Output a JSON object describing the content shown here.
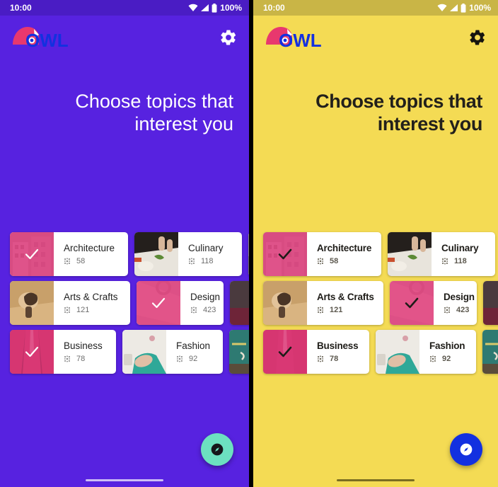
{
  "screens": [
    {
      "theme": "purple",
      "background_color": "#5722E0",
      "statusbar": {
        "time": "10:00",
        "battery": "100%",
        "wifi_icon": "wifi-icon",
        "signal_icon": "signal-icon",
        "battery_icon": "battery-icon"
      },
      "appbar": {
        "logo_text": "OWL",
        "logo_icon": "owl-logo-icon",
        "settings_icon": "gear-icon"
      },
      "headline": "Choose topics that interest you",
      "fab": {
        "icon": "explore-compass-icon",
        "color": "#6CE0C0"
      }
    },
    {
      "theme": "yellow",
      "background_color": "#F4DB54",
      "statusbar": {
        "time": "10:00",
        "battery": "100%",
        "wifi_icon": "wifi-icon",
        "signal_icon": "signal-icon",
        "battery_icon": "battery-icon"
      },
      "appbar": {
        "logo_text": "OWL",
        "logo_icon": "owl-logo-icon",
        "settings_icon": "gear-icon"
      },
      "headline": "Choose topics that interest you",
      "fab": {
        "icon": "explore-compass-icon",
        "color": "#1330E0"
      }
    }
  ],
  "topics": {
    "selection_tint_color": "#E53B7E",
    "count_icon": "grain-icon",
    "rows": [
      [
        {
          "name": "Architecture",
          "count": "58",
          "selected": true,
          "image": "architecture-building-photo"
        },
        {
          "name": "Culinary",
          "count": "118",
          "selected": false,
          "image": "culinary-chopping-photo"
        },
        {
          "name": "",
          "count": "",
          "selected": false,
          "image": "partial-card-photo",
          "partial": true
        }
      ],
      [
        {
          "name": "Arts & Crafts",
          "count": "121",
          "selected": false,
          "image": "pottery-hands-photo"
        },
        {
          "name": "Design",
          "count": "423",
          "selected": true,
          "image": "design-fabric-photo"
        },
        {
          "name": "",
          "count": "",
          "selected": false,
          "image": "partial-card-photo",
          "partial": true
        }
      ],
      [
        {
          "name": "Business",
          "count": "78",
          "selected": true,
          "image": "business-suit-photo"
        },
        {
          "name": "Fashion",
          "count": "92",
          "selected": false,
          "image": "fashion-sewing-photo"
        },
        {
          "name": "",
          "count": "",
          "selected": false,
          "image": "chalkboard-photo",
          "partial": true
        }
      ]
    ]
  }
}
